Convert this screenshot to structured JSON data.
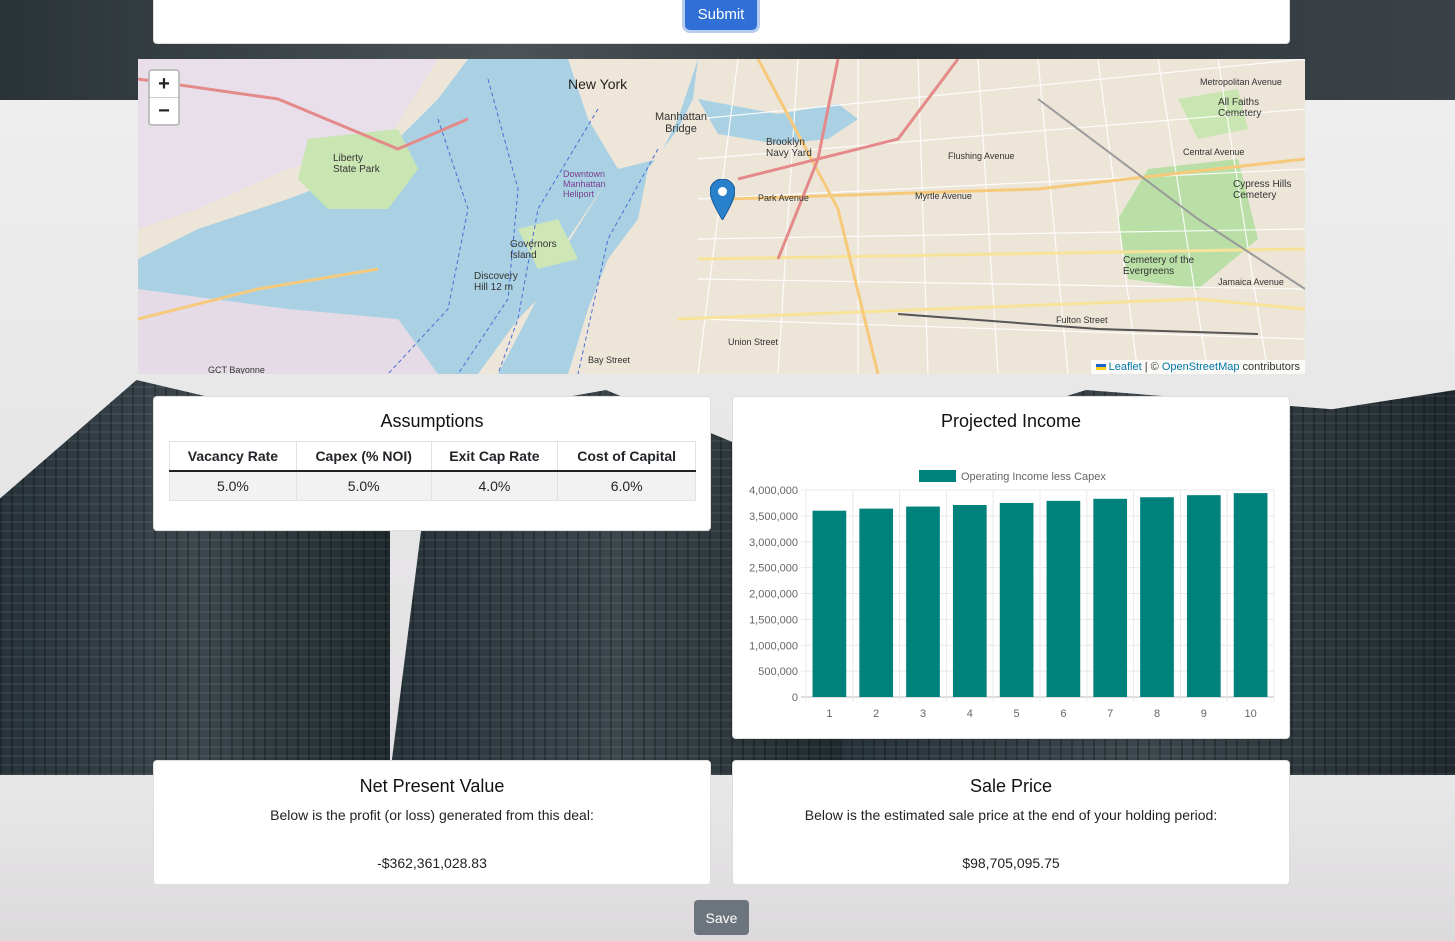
{
  "form": {
    "submit_label": "Submit"
  },
  "map": {
    "zoom_in": "+",
    "zoom_out": "−",
    "attribution": {
      "leaflet": "Leaflet",
      "sep": " | © ",
      "osm": "OpenStreetMap",
      "suffix": " contributors"
    },
    "labels": {
      "new_york": "New York",
      "manhattan_bridge": "Manhattan Bridge",
      "brooklyn_navy_yard": "Brooklyn Navy Yard",
      "liberty_state_park": "Liberty State Park",
      "governors_island": "Governors Island",
      "discovery_hill": "Discovery Hill 12 m",
      "downtown_heliport": "Downtown Manhattan Heliport",
      "cypress_hills": "Cypress Hills Cemetery",
      "cemetery_evergreens": "Cemetery of the Evergreens",
      "all_faiths": "All Faiths Cemetery",
      "gct_bayonne": "GCT Bayonne",
      "myrtle_avenue": "Myrtle Avenue",
      "flushing_avenue": "Flushing Avenue",
      "union_street": "Union Street",
      "fulton_street": "Fulton Street",
      "central_avenue": "Central Avenue",
      "metropolitan_avenue": "Metropolitan Avenue",
      "park_avenue": "Park Avenue",
      "jamaica_avenue": "Jamaica Avenue",
      "bay_street": "Bay Street"
    }
  },
  "assumptions": {
    "title": "Assumptions",
    "headers": [
      "Vacancy Rate",
      "Capex (% NOI)",
      "Exit Cap Rate",
      "Cost of Capital"
    ],
    "values": [
      "5.0%",
      "5.0%",
      "4.0%",
      "6.0%"
    ]
  },
  "income": {
    "title": "Projected Income"
  },
  "chart_data": {
    "type": "bar",
    "categories": [
      "1",
      "2",
      "3",
      "4",
      "5",
      "6",
      "7",
      "8",
      "9",
      "10"
    ],
    "series": [
      {
        "name": "Operating Income less Capex",
        "values": [
          3600000,
          3640000,
          3680000,
          3710000,
          3750000,
          3790000,
          3830000,
          3860000,
          3900000,
          3940000
        ]
      }
    ],
    "ylim": [
      0,
      4000000
    ],
    "yticks": [
      "0",
      "500,000",
      "1,000,000",
      "1,500,000",
      "2,000,000",
      "2,500,000",
      "3,000,000",
      "3,500,000",
      "4,000,000"
    ],
    "color": "#00827c",
    "legend": "top",
    "grid": true
  },
  "npv": {
    "title": "Net Present Value",
    "description": "Below is the profit (or loss) generated from this deal:",
    "value": "-$362,361,028.83"
  },
  "sale": {
    "title": "Sale Price",
    "description": "Below is the estimated sale price at the end of your holding period:",
    "value": "$98,705,095.75"
  },
  "save_label": "Save"
}
